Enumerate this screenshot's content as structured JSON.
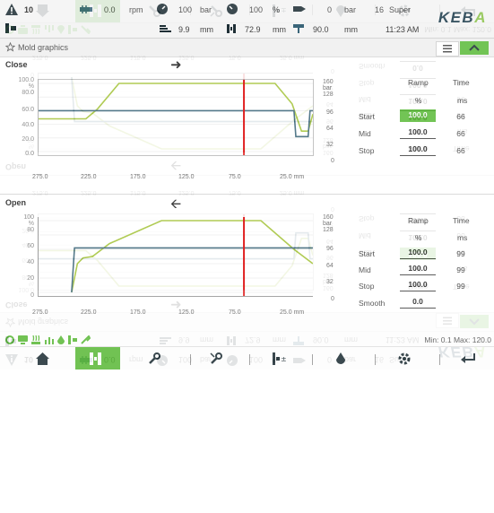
{
  "status": {
    "alarm_count": "10",
    "rpm_value": "0.0",
    "rpm_unit": "rpm",
    "pressure_value": "100",
    "pressure_unit": "bar",
    "percent_value": "100",
    "percent_unit": "%",
    "flow_value": "0",
    "flow_unit": "bar",
    "mode_number": "16",
    "mode_label": "Super",
    "stroke_value": "9.9",
    "stroke_unit": "mm",
    "mold_value": "72.9",
    "mold_unit": "mm",
    "ejector_value": "90.0",
    "ejector_unit": "mm",
    "time": "11:23 AM",
    "logo": "KEBA"
  },
  "page": {
    "title": "Mold graphics"
  },
  "close_panel": {
    "title": "Close",
    "direction_icon": "arrow-right-icon",
    "ramp_header": "Ramp",
    "ramp_unit": "%",
    "time_header": "Time",
    "time_unit": "ms",
    "rows": [
      {
        "label": "Start",
        "ramp": "100.0",
        "time": "66"
      },
      {
        "label": "Mid",
        "ramp": "100.0",
        "time": "66"
      },
      {
        "label": "Stop",
        "ramp": "100.0",
        "time": "66"
      }
    ],
    "y_ticks_left": [
      "100.0",
      "%",
      "80.0",
      "60.0",
      "40.0",
      "20.0",
      "0.0"
    ],
    "y_ticks_right": [
      "160",
      "bar",
      "128",
      "96",
      "64",
      "32",
      "0"
    ],
    "x_ticks": [
      "275.0",
      "225.0",
      "175.0",
      "125.0",
      "75.0",
      "25.0 mm"
    ]
  },
  "open_panel": {
    "title": "Open",
    "direction_icon": "arrow-left-icon",
    "ramp_header": "Ramp",
    "ramp_unit": "%",
    "time_header": "Time",
    "time_unit": "ms",
    "rows": [
      {
        "label": "Start",
        "ramp": "100.0",
        "time": "99"
      },
      {
        "label": "Mid",
        "ramp": "100.0",
        "time": "99"
      },
      {
        "label": "Stop",
        "ramp": "100.0",
        "time": "99"
      },
      {
        "label": "Smooth",
        "ramp": "0.0",
        "time": ""
      }
    ],
    "y_ticks_left": [
      "100",
      "%",
      "80",
      "60",
      "40",
      "20",
      "0"
    ],
    "y_ticks_right": [
      "160",
      "bar",
      "128",
      "96",
      "64",
      "32",
      "0"
    ],
    "x_ticks": [
      "275.0",
      "225.0",
      "175.0",
      "125.0",
      "75.0",
      "25.0 mm"
    ]
  },
  "footer": {
    "minmax": "Min: 0.1 Max: 120.0"
  },
  "nav": [
    "home-icon",
    "mold-icon",
    "wrench-icon",
    "tools-icon",
    "ejector-icon",
    "injection-icon",
    "settings-icon",
    "back-icon"
  ],
  "colors": {
    "accent_green": "#5dbb3b",
    "curve_yellowgreen": "#a5c43a",
    "curve_blue": "#3a6579",
    "marker_red": "#e02020"
  },
  "chart_data": [
    {
      "type": "line",
      "title": "Close",
      "xlabel": "mm",
      "ylabel": "%",
      "xlim": [
        290,
        0
      ],
      "ylim": [
        0,
        100
      ],
      "series": [
        {
          "values": [
            [
              290,
              48
            ],
            [
              240,
              48
            ],
            [
              228,
              62
            ],
            [
              205,
              100
            ],
            [
              40,
              100
            ],
            [
              22,
              70
            ],
            [
              12,
              30
            ],
            [
              5,
              30
            ],
            [
              0,
              55
            ]
          ]
        },
        {
          "values": [
            [
              290,
              60
            ],
            [
              20,
              60
            ],
            [
              18,
              22
            ],
            [
              5,
              22
            ],
            [
              3,
              60
            ],
            [
              0,
              60
            ]
          ]
        }
      ],
      "position_marker_mm": 72.9
    },
    {
      "type": "line",
      "title": "Open",
      "xlabel": "mm",
      "ylabel": "%",
      "xlim": [
        290,
        0
      ],
      "ylim": [
        0,
        100
      ],
      "series": [
        {
          "values": [
            [
              255,
              0
            ],
            [
              249,
              40
            ],
            [
              243,
              48
            ],
            [
              233,
              50
            ],
            [
              215,
              68
            ],
            [
              160,
              100
            ],
            [
              55,
              100
            ],
            [
              20,
              60
            ],
            [
              0,
              40
            ]
          ]
        },
        {
          "values": [
            [
              255,
              0
            ],
            [
              252,
              62
            ],
            [
              0,
              62
            ]
          ]
        }
      ],
      "position_marker_mm": 72.9
    }
  ]
}
